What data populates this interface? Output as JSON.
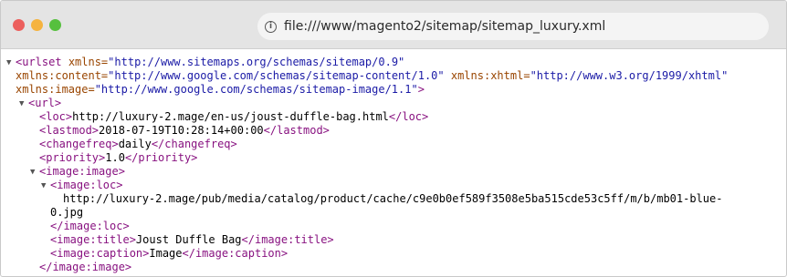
{
  "window": {
    "traffic_lights": [
      {
        "name": "close",
        "color": "#ec5f5d"
      },
      {
        "name": "minimize",
        "color": "#f5b33f"
      },
      {
        "name": "maximize",
        "color": "#56c03e"
      }
    ],
    "address_bar": {
      "icon": "info-icon",
      "url": "file:///www/magento2/sitemap/sitemap_luxury.xml"
    }
  },
  "colors": {
    "tag": "#881280",
    "attribute": "#994500",
    "attribute_value": "#1a1aa6",
    "text": "#000000"
  },
  "xml": {
    "urlset_open": "<urlset",
    "xmlns_attr": "xmlns=",
    "xmlns_val": "\"http://www.sitemaps.org/schemas/sitemap/0.9\"",
    "content_attr": "xmlns:content=",
    "content_val": "\"http://www.google.com/schemas/sitemap-content/1.0\"",
    "xhtml_attr": "xmlns:xhtml=",
    "xhtml_val": "\"http://www.w3.org/1999/xhtml\"",
    "image_attr": "xmlns:image=",
    "image_val": "\"http://www.google.com/schemas/sitemap-image/1.1\"",
    "tag_close": ">",
    "url_open": "<url>",
    "loc_open": "<loc>",
    "loc_text": "http://luxury-2.mage/en-us/joust-duffle-bag.html",
    "loc_close": "</loc>",
    "lastmod_open": "<lastmod>",
    "lastmod_text": "2018-07-19T10:28:14+00:00",
    "lastmod_close": "</lastmod>",
    "changefreq_open": "<changefreq>",
    "changefreq_text": "daily",
    "changefreq_close": "</changefreq>",
    "priority_open": "<priority>",
    "priority_text": "1.0",
    "priority_close": "</priority>",
    "image_image_open": "<image:image>",
    "image_loc_open": "<image:loc>",
    "image_loc_text_1": "http://luxury-2.mage/pub/media/catalog/product/cache/c9e0b0ef589f3508e5ba515cde53c5ff/m/b/mb01-blue-",
    "image_loc_text_2": "0.jpg",
    "image_loc_close": "</image:loc>",
    "image_title_open": "<image:title>",
    "image_title_text": "Joust Duffle Bag",
    "image_title_close": "</image:title>",
    "image_caption_open": "<image:caption>",
    "image_caption_text": "Image",
    "image_caption_close": "</image:caption>",
    "image_image_close": "</image:image>"
  },
  "tree_toggle_glyph": "▼"
}
